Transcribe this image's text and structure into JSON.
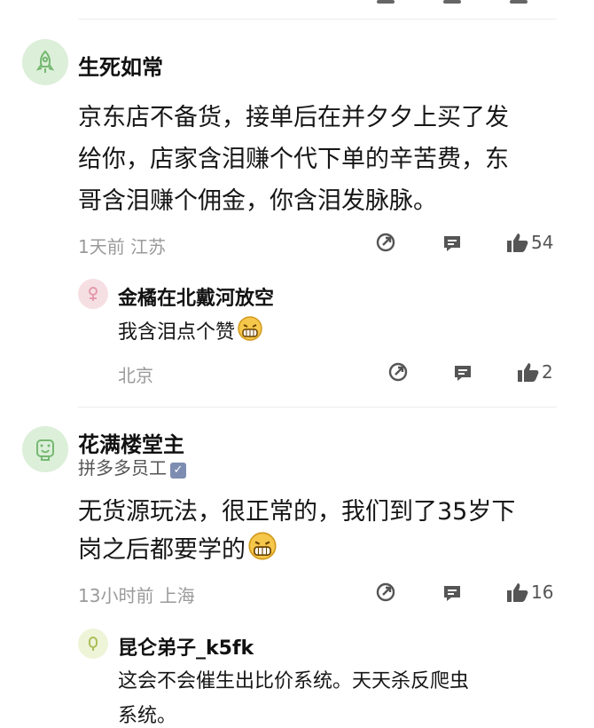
{
  "comments": [
    {
      "name": "生死如常",
      "text_lines": [
        "京东店不备货，接单后在并夕夕上买了发",
        "给你，店家含泪赚个代下单的辛苦费，东",
        "哥含泪赚个佣金，你含泪发脉脉。"
      ],
      "time_location": "1天前  江苏",
      "likes": "54",
      "avatar_color": "#dff0dd",
      "reply": {
        "name": "金橘在北戴河放空",
        "text": "我含泪点个赞",
        "location": "北京",
        "likes": "2",
        "avatar_color": "#f6dfe3"
      }
    },
    {
      "name": "花满楼堂主",
      "tag": "拼多多员工",
      "text_lines": [
        "无货源玩法，很正常的，我们到了35岁下",
        "岗之后都要学的"
      ],
      "time_location": "13小时前  上海",
      "likes": "16",
      "avatar_color": "#dff0dd",
      "reply": {
        "name": "昆仑弟子_k5fk",
        "text_lines": [
          "这会不会催生出比价系统。天天杀反爬虫",
          "系统。"
        ],
        "avatar_color": "#eef4d8"
      }
    }
  ],
  "icons": [
    "share-icon",
    "comment-icon",
    "thumb-up-icon",
    "grin-emoji-icon",
    "verified-badge-icon"
  ]
}
